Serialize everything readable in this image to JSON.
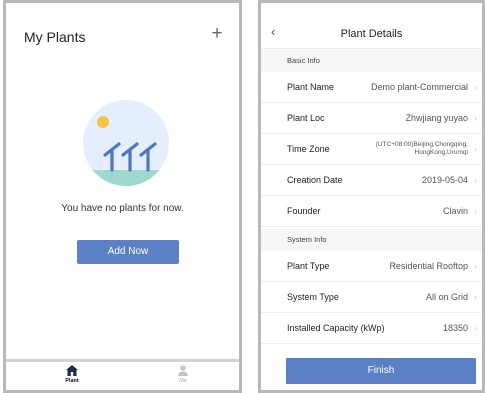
{
  "left": {
    "title": "My Plants",
    "add_icon": "plus-icon",
    "empty_message": "You have no plants for now.",
    "add_button": "Add Now",
    "nav": [
      {
        "label": "Plant",
        "icon": "home-icon",
        "active": true
      },
      {
        "label": "Me",
        "icon": "person-icon",
        "active": false
      }
    ],
    "colors": {
      "accent": "#5b80c6",
      "illustration_bg": "#e4eefc",
      "sun": "#f5c542",
      "panel": "#4e76c4",
      "ground": "#9fd8cf"
    }
  },
  "right": {
    "title": "Plant Details",
    "back_icon": "chevron-left-icon",
    "sections": [
      {
        "header": "Basic Info",
        "rows": [
          {
            "label": "Plant Name",
            "value": "Demo plant-Commercial"
          },
          {
            "label": "Plant Loc",
            "value": "Zhwjiang yuyao"
          },
          {
            "label": "Time Zone",
            "value": "(UTC+08:00)Beijing,Chongqing, HongKong,Urumqi"
          },
          {
            "label": "Creation Date",
            "value": "2019-05-04"
          },
          {
            "label": "Founder",
            "value": "Clavin"
          }
        ]
      },
      {
        "header": "System Info",
        "rows": [
          {
            "label": "Plant Type",
            "value": "Residential Rooftop"
          },
          {
            "label": "System Type",
            "value": "All on Grid"
          },
          {
            "label": "Installed Capacity (kWp)",
            "value": "18350"
          }
        ]
      }
    ],
    "finish_button": "Finish",
    "chevron_icon": "chevron-right-icon"
  }
}
